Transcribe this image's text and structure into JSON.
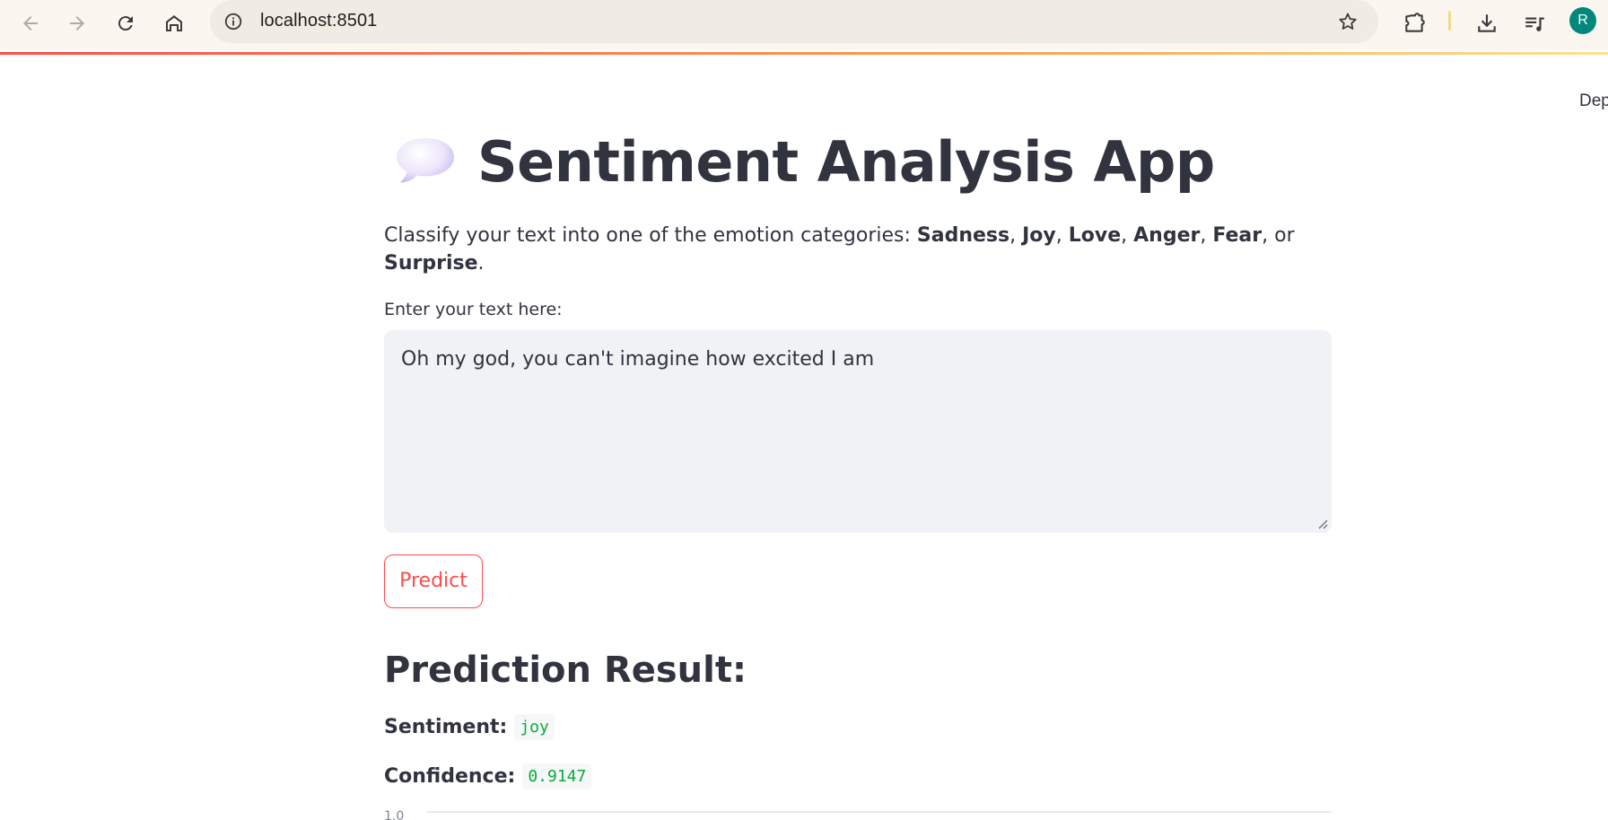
{
  "browser": {
    "url": "localhost:8501",
    "avatar_letter": "R",
    "icons": {
      "back": "arrow-left-icon",
      "forward": "arrow-right-icon",
      "reload": "reload-icon",
      "home": "home-icon",
      "site_info": "info-icon",
      "bookmark": "star-icon",
      "extensions": "puzzle-icon",
      "downloads": "download-icon",
      "media": "media-queue-icon"
    }
  },
  "header": {
    "deploy_label": "Deploy"
  },
  "app": {
    "title_emoji": "speech-bubble-icon",
    "title": "Sentiment Analysis App",
    "description_prefix": "Classify your text into one of the emotion categories: ",
    "emotions": [
      "Sadness",
      "Joy",
      "Love",
      "Anger",
      "Fear",
      "Surprise"
    ],
    "sep_comma": ", ",
    "sep_or": ", or ",
    "description_suffix": ".",
    "input_label": "Enter your text here:",
    "input_value": "Oh my god, you can't imagine how excited I am",
    "predict_label": "Predict"
  },
  "result": {
    "heading": "Prediction Result:",
    "sentiment_label": "Sentiment:",
    "sentiment_value": "joy",
    "confidence_label": "Confidence:",
    "confidence_value": "0.9147"
  },
  "chart": {
    "first_tick": "1.0"
  },
  "colors": {
    "accent": "#ff4b4b",
    "code_green": "#09ab3b",
    "text": "#31333f",
    "avatar": "#00897b"
  }
}
